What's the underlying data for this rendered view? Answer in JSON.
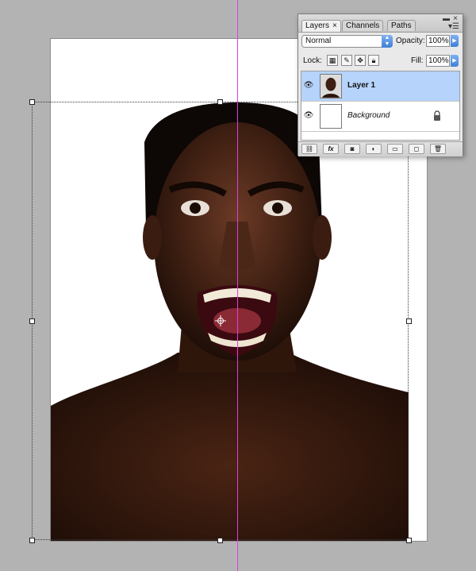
{
  "palette": {
    "tabs": [
      {
        "label": "Layers",
        "active": true
      },
      {
        "label": "Channels",
        "active": false
      },
      {
        "label": "Paths",
        "active": false
      }
    ],
    "close_glyph": "×",
    "blend_mode": "Normal",
    "opacity_label": "Opacity:",
    "opacity_value": "100%",
    "lock_label": "Lock:",
    "fill_label": "Fill:",
    "fill_value": "100%",
    "layers": [
      {
        "name": "Layer 1",
        "selected": true,
        "visible": true,
        "locked": false
      },
      {
        "name": "Background",
        "selected": false,
        "visible": true,
        "locked": true
      }
    ],
    "bottom_buttons": [
      "link-layers",
      "fx",
      "mask",
      "adjustment",
      "group",
      "new-layer",
      "delete"
    ],
    "fx_label": "fx"
  },
  "colors": {
    "workspace": "#b3b3b3",
    "guide": "#e33ce3",
    "selection": "#b5d3fb",
    "accent": "#3d7fd6"
  }
}
